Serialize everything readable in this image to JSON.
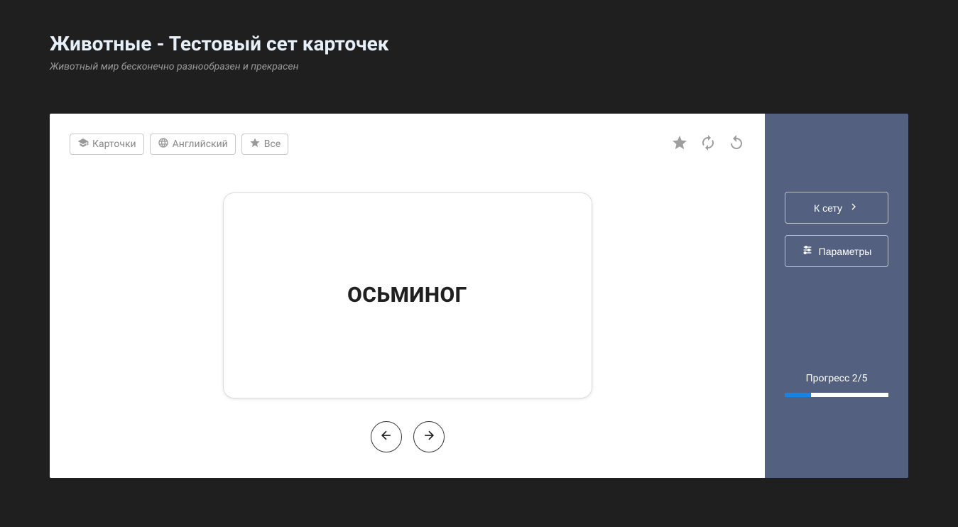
{
  "header": {
    "title": "Животные - Тестовый сет карточек",
    "subtitle": "Животный мир бесконечно разнообразен и прекрасен"
  },
  "toolbar": {
    "chips": {
      "mode": "Карточки",
      "language": "Английский",
      "filter": "Все"
    }
  },
  "card": {
    "text": "ОСЬМИНОГ"
  },
  "sidebar": {
    "to_set_label": "К сету",
    "params_label": "Параметры",
    "progress_label": "Прогресс 2/5",
    "progress_current": 2,
    "progress_total": 5,
    "progress_percent": 25
  }
}
